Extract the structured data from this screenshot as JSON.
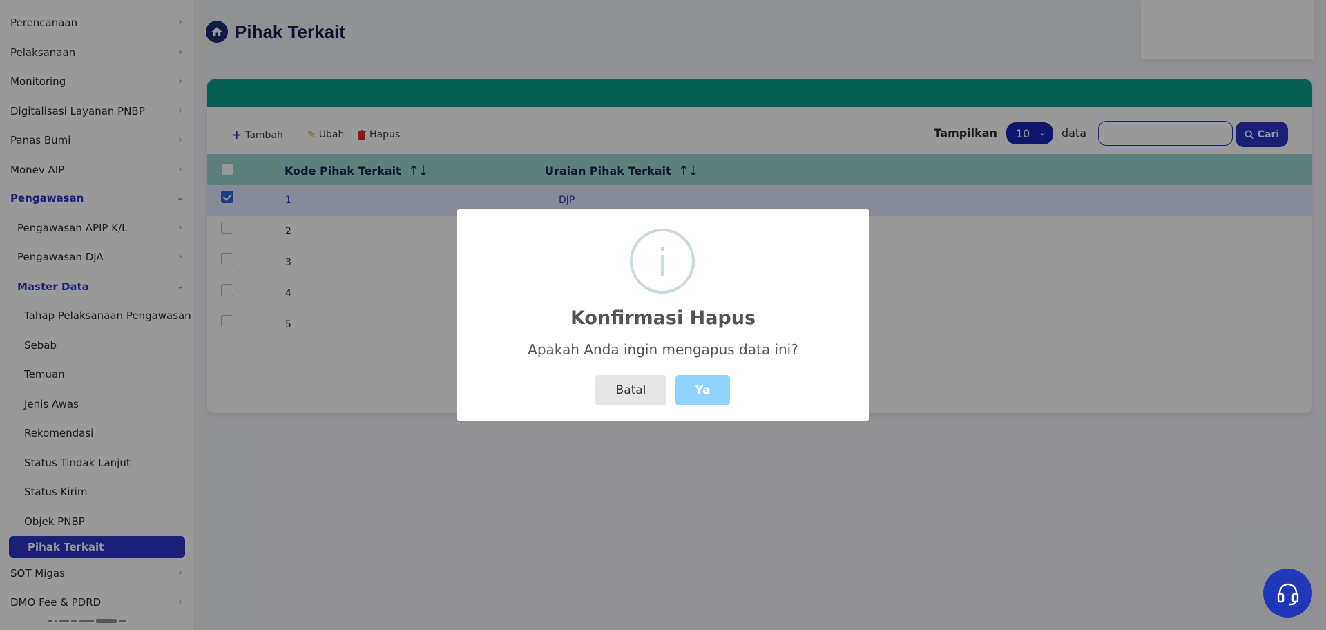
{
  "sidebar": {
    "items": [
      {
        "label": "Perencanaan"
      },
      {
        "label": "Pelaksanaan"
      },
      {
        "label": "Monitoring"
      },
      {
        "label": "Digitalisasi Layanan PNBP"
      },
      {
        "label": "Panas Bumi"
      },
      {
        "label": "Monev AIP"
      },
      {
        "label": "Pengawasan"
      },
      {
        "label": "Pengawasan APIP K/L"
      },
      {
        "label": "Pengawasan DJA"
      },
      {
        "label": "Master Data"
      },
      {
        "label": "Tahap Pelaksanaan Pengawasan"
      },
      {
        "label": "Sebab"
      },
      {
        "label": "Temuan"
      },
      {
        "label": "Jenis Awas"
      },
      {
        "label": "Rekomendasi"
      },
      {
        "label": "Status Tindak Lanjut"
      },
      {
        "label": "Status Kirim"
      },
      {
        "label": "Objek PNBP"
      },
      {
        "label": "Pihak Terkait"
      },
      {
        "label": "SOT Migas"
      },
      {
        "label": "DMO Fee & PDRD"
      }
    ]
  },
  "page": {
    "title": "Pihak Terkait"
  },
  "toolbar": {
    "tambah": "Tambah",
    "ubah": "Ubah",
    "hapus": "Hapus",
    "tampilkan": "Tampilkan",
    "page_length": "10",
    "data_label": "data",
    "search_value": "",
    "cari": "Cari"
  },
  "table": {
    "headers": [
      "Kode Pihak Terkait",
      "Uraian Pihak Terkait"
    ],
    "rows": [
      {
        "kode": "1",
        "uraian": "DJP",
        "checked": true
      },
      {
        "kode": "2",
        "uraian": "",
        "checked": false
      },
      {
        "kode": "3",
        "uraian": "",
        "checked": false
      },
      {
        "kode": "4",
        "uraian": "",
        "checked": false
      },
      {
        "kode": "5",
        "uraian": "",
        "checked": false
      }
    ]
  },
  "modal": {
    "icon": "info-icon",
    "title": "Konfirmasi Hapus",
    "text": "Apakah Anda ingin mengapus data ini?",
    "cancel": "Batal",
    "confirm": "Ya"
  },
  "colors": {
    "primary": "#2d35c6",
    "band": "#0a9f87",
    "table_header": "#9ad8cf",
    "confirm_button": "#8fd3fe"
  }
}
